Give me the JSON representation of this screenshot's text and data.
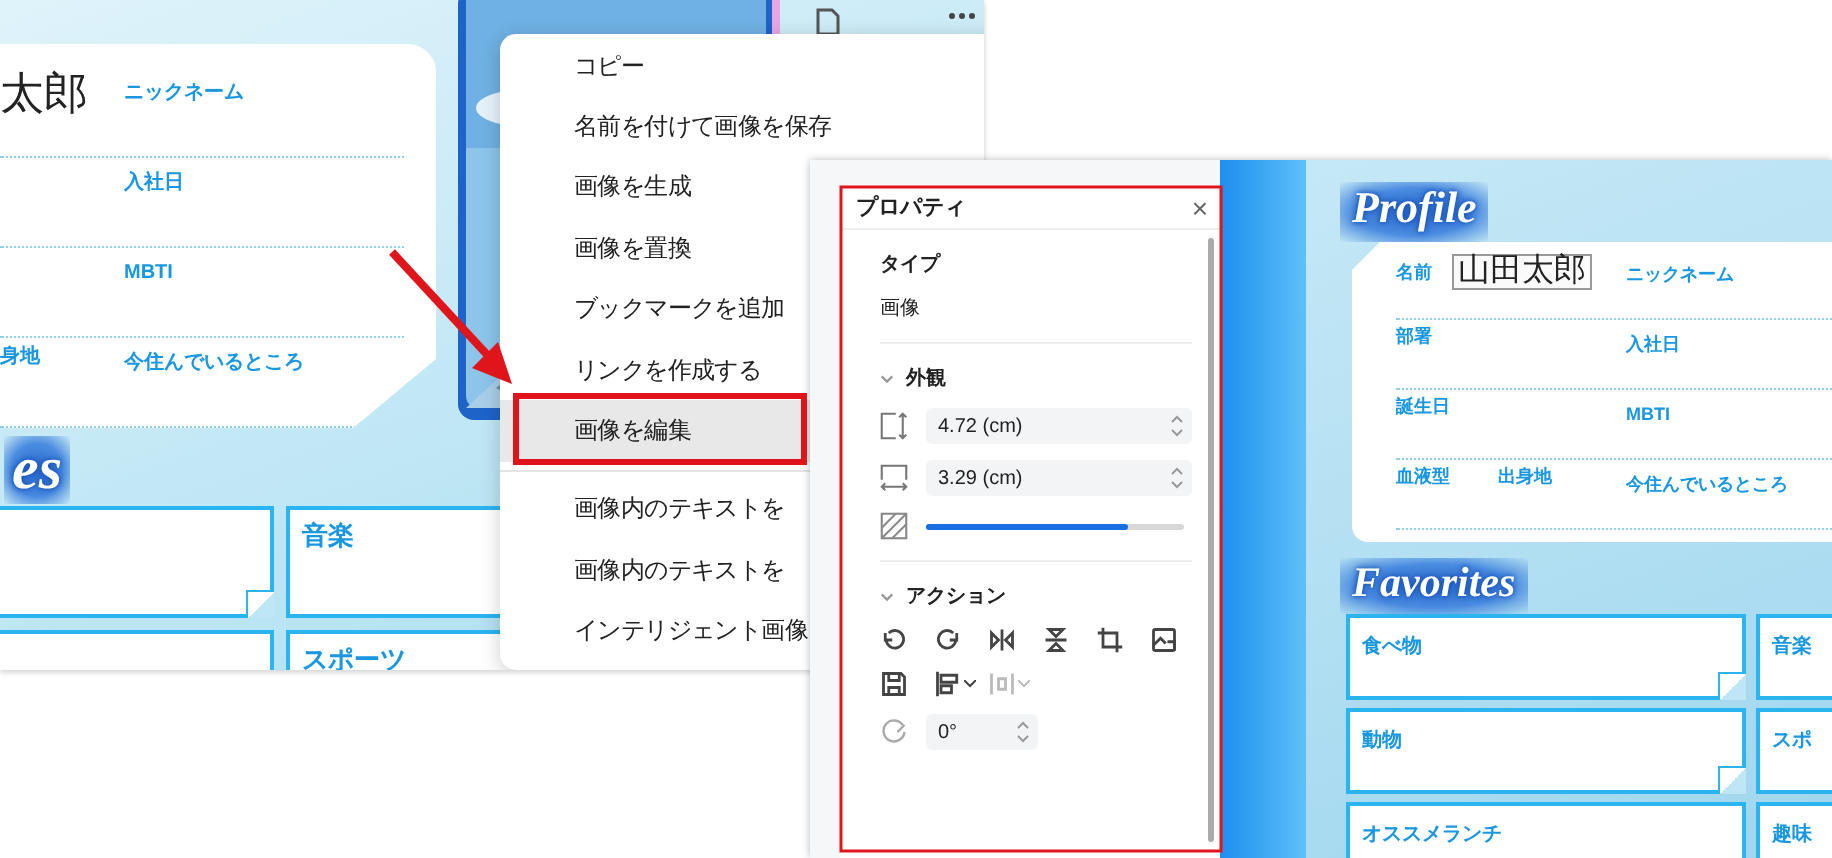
{
  "left_screenshot": {
    "profile_card": {
      "rows": [
        {
          "left": [
            {
              "kind": "value",
              "text": "太郎"
            }
          ],
          "right": [
            {
              "kind": "label",
              "text": "ニックネーム"
            }
          ]
        },
        {
          "right": [
            {
              "kind": "label",
              "text": "入社日"
            }
          ]
        },
        {
          "right": [
            {
              "kind": "label",
              "text": "MBTI"
            }
          ]
        },
        {
          "left": [
            {
              "kind": "label",
              "text": "身地"
            }
          ],
          "right": [
            {
              "kind": "label",
              "text": "今住んでいるところ"
            }
          ]
        }
      ]
    },
    "favorites_heading": "es",
    "favorite_cards": [
      {
        "kind": "blank",
        "folded_corner": true
      },
      {
        "kind": "labeled",
        "label": "音楽"
      },
      {
        "kind": "blank"
      },
      {
        "kind": "labeled",
        "label": "スポーツ"
      }
    ],
    "context_menu": {
      "items": [
        {
          "kind": "item",
          "label": "コピー",
          "selected": false
        },
        {
          "kind": "item",
          "label": "名前を付けて画像を保存",
          "selected": false
        },
        {
          "kind": "item",
          "label": "画像を生成",
          "selected": false
        },
        {
          "kind": "item",
          "label": "画像を置換",
          "selected": false
        },
        {
          "kind": "item",
          "label": "ブックマークを追加",
          "selected": false
        },
        {
          "kind": "item",
          "label": "リンクを作成する",
          "selected": false
        },
        {
          "kind": "item",
          "label": "画像を編集",
          "selected": true
        },
        {
          "kind": "divider"
        },
        {
          "kind": "item",
          "label": "画像内のテキストを",
          "selected": false
        },
        {
          "kind": "item",
          "label": "画像内のテキストを",
          "selected": false
        },
        {
          "kind": "item",
          "label": "インテリジェント画像",
          "selected": false
        }
      ]
    }
  },
  "right_screenshot": {
    "properties_panel": {
      "title": "プロパティ",
      "close": "×",
      "type_label": "タイプ",
      "type_value": "画像",
      "appearance": {
        "title": "外観",
        "expanded": true,
        "height": "4.72 (cm)",
        "width": "3.29 (cm)",
        "opacity": {
          "level": 0.78
        }
      },
      "actions": {
        "title": "アクション",
        "expanded": true,
        "tools": [
          {
            "kind": "rotate-left",
            "disabled": false
          },
          {
            "kind": "rotate-right",
            "disabled": false
          },
          {
            "kind": "flip-horizontal",
            "disabled": false
          },
          {
            "kind": "flip-vertical",
            "disabled": false
          },
          {
            "kind": "crop",
            "disabled": false
          },
          {
            "kind": "replace",
            "disabled": false
          },
          {
            "kind": "save",
            "disabled": false
          },
          {
            "kind": "align",
            "disabled": false
          },
          {
            "kind": "distribute",
            "disabled": true
          }
        ],
        "rotation": "0°"
      }
    },
    "document": {
      "profile_heading": "Profile",
      "rows": [
        {
          "left": [
            {
              "kind": "label",
              "text": "名前"
            },
            {
              "kind": "value",
              "text": "山田太郎"
            }
          ],
          "right": [
            {
              "kind": "label",
              "text": "ニックネーム"
            }
          ]
        },
        {
          "left": [
            {
              "kind": "label",
              "text": "部署"
            }
          ],
          "right": [
            {
              "kind": "label",
              "text": "入社日"
            }
          ]
        },
        {
          "left": [
            {
              "kind": "label",
              "text": "誕生日"
            }
          ],
          "right": [
            {
              "kind": "label",
              "text": "MBTI"
            }
          ]
        },
        {
          "left": [
            {
              "kind": "label",
              "text": "血液型"
            },
            {
              "kind": "label",
              "text": "出身地"
            }
          ],
          "right": [
            {
              "kind": "label",
              "text": "今住んでいるところ"
            }
          ]
        }
      ],
      "favorites_heading": "Favorites",
      "favorite_cards": [
        {
          "kind": "labeled",
          "label": "食べ物",
          "folded_corner": true
        },
        {
          "kind": "labeled",
          "label": "音楽"
        },
        {
          "kind": "labeled",
          "label": "動物",
          "folded_corner": true
        },
        {
          "kind": "labeled",
          "label": "スポ"
        },
        {
          "kind": "labeled",
          "label": "オススメランチ"
        },
        {
          "kind": "labeled",
          "label": "趣味"
        }
      ]
    }
  }
}
